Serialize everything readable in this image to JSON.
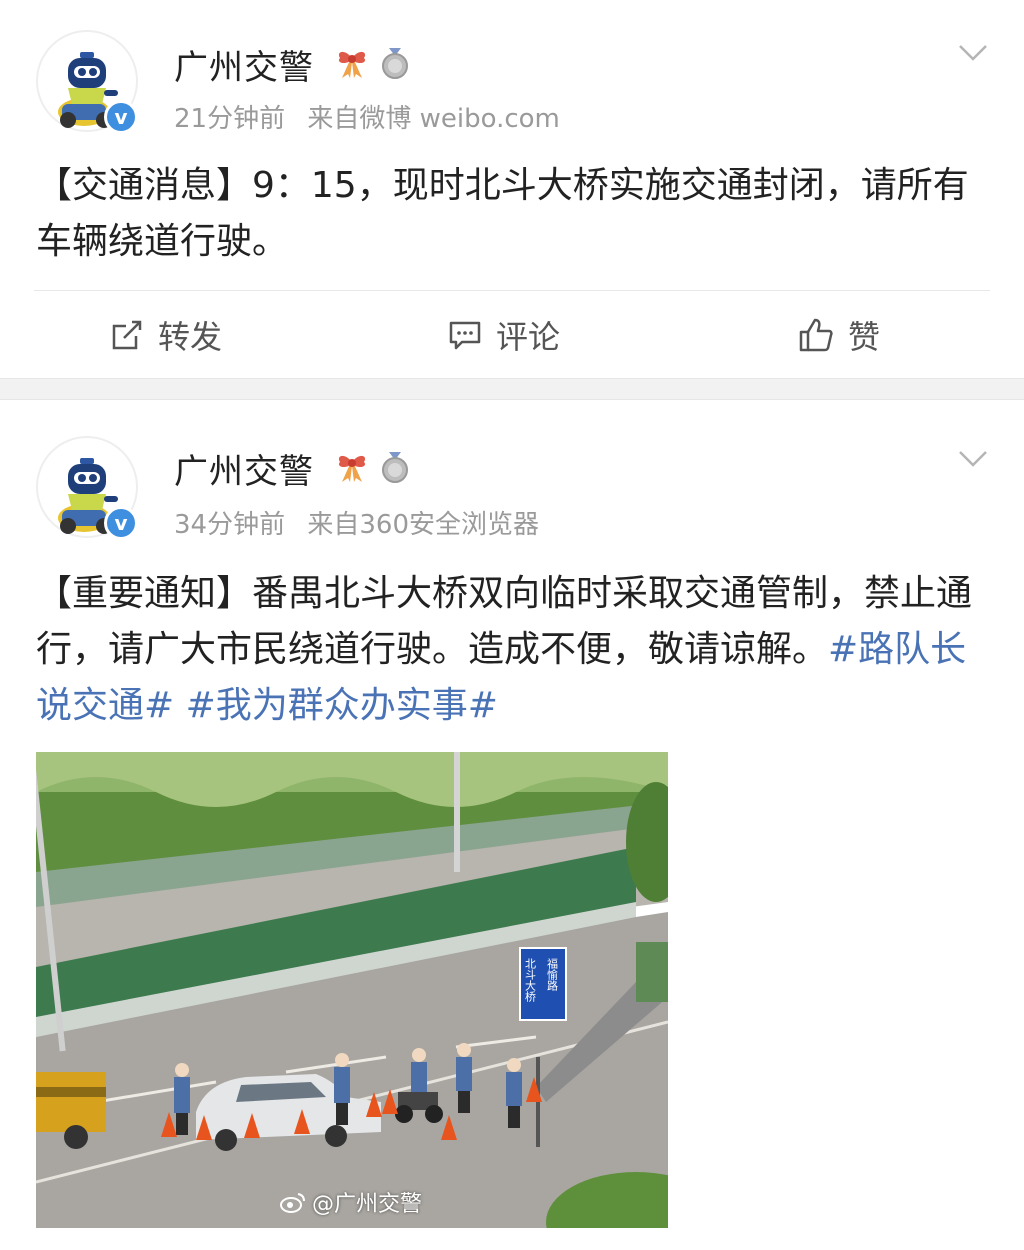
{
  "posts": [
    {
      "author": "广州交警",
      "time": "21分钟前",
      "source": "来自微博 weibo.com",
      "text": "【交通消息】9：15，现时北斗大桥实施交通封闭，请所有车辆绕道行驶。",
      "actions": {
        "repost": "转发",
        "comment": "评论",
        "like": "赞"
      }
    },
    {
      "author": "广州交警",
      "time": "34分钟前",
      "source": "来自360安全浏览器",
      "text": "【重要通知】番禺北斗大桥双向临时采取交通管制，禁止通行，请广大市民绕道行驶。造成不便，敬请谅解。",
      "tags": [
        "#路队长说交通#",
        "#我为群众办实事#"
      ],
      "image": {
        "sign_text_left": "北斗大桥",
        "sign_text_right": "福愉路",
        "watermark": "@广州交警"
      }
    }
  ],
  "colors": {
    "link": "#4a73b6",
    "verified": "#3f8fe0",
    "divider": "#f2f2f2"
  }
}
